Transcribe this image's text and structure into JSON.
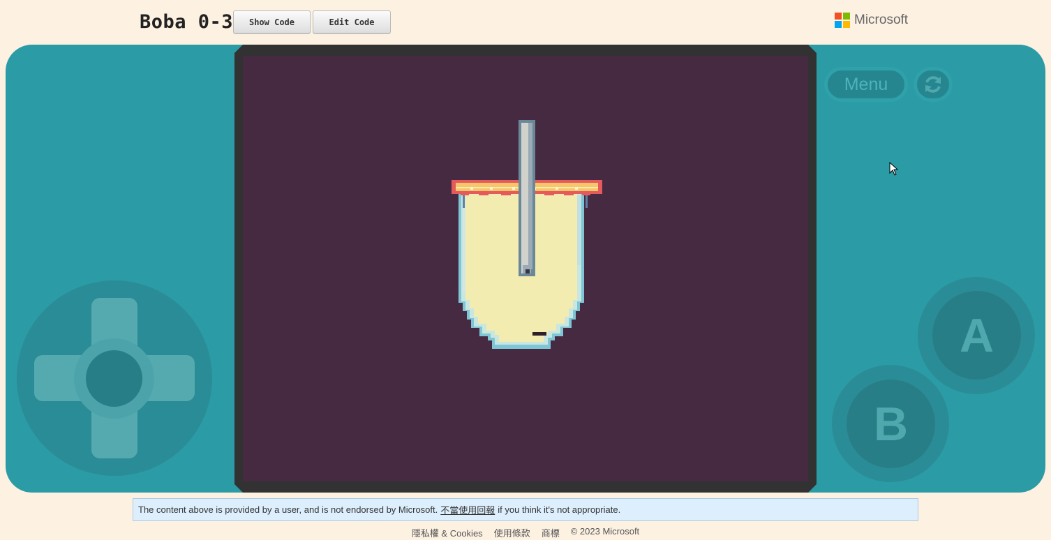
{
  "header": {
    "title": "Boba 0-3",
    "show_code_label": "Show Code",
    "edit_code_label": "Edit Code",
    "brand": "Microsoft"
  },
  "controls": {
    "menu_label": "Menu",
    "a_label": "A",
    "b_label": "B",
    "reset_icon": "refresh-icon"
  },
  "notice": {
    "before": "The content above is provided by a user, and is not endorsed by Microsoft.",
    "link": "不當使用回報",
    "after": "if you think it's not appropriate."
  },
  "footer": {
    "privacy": "隱私權 & Cookies",
    "terms": "使用條款",
    "trademarks": "商標",
    "copyright": "© 2023 Microsoft"
  },
  "colors": {
    "console": "#2b9ba5",
    "screen_bg": "#462a42",
    "page_bg": "#fdf1e2",
    "ms_red": "#f25022",
    "ms_green": "#7fba00",
    "ms_blue": "#00a4ef",
    "ms_yellow": "#ffb900"
  }
}
